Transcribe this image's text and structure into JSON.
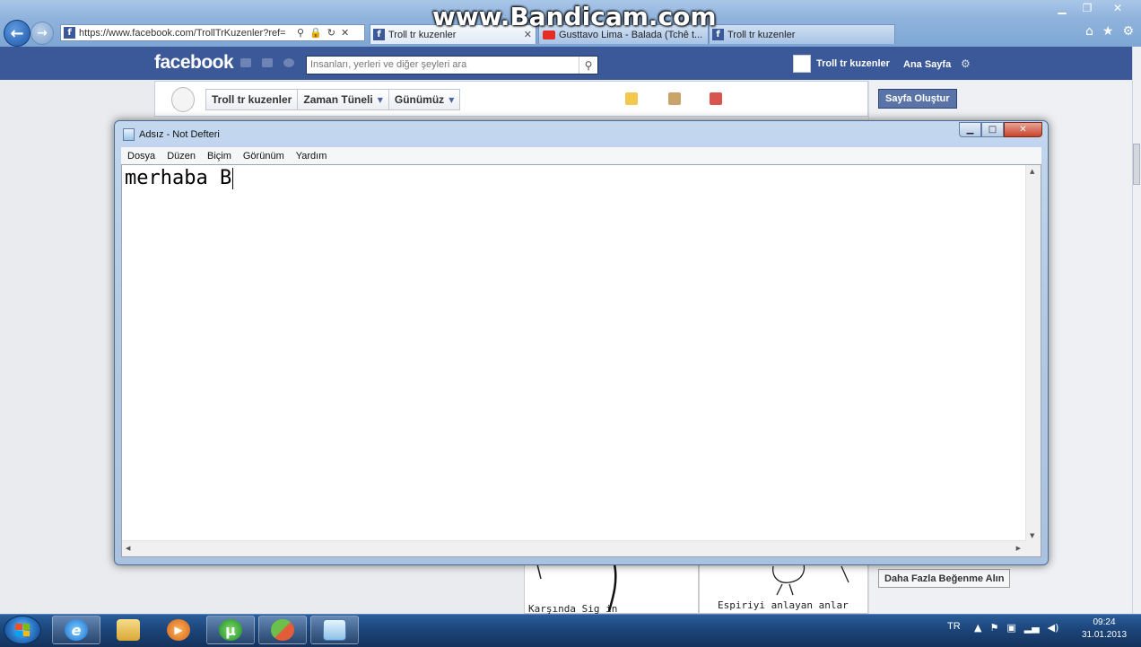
{
  "watermark": "www.Bandicam.com",
  "browser": {
    "address": "https://www.facebook.com/TrollTrKuzenler?ref=",
    "tabs": [
      {
        "label": "Troll tr kuzenler",
        "active": true
      },
      {
        "label": "Gusttavo Lima - Balada (Tchê t...",
        "active": false
      },
      {
        "label": "Troll tr kuzenler",
        "active": false
      }
    ]
  },
  "facebook": {
    "logo": "facebook",
    "search_placeholder": "Insanları, yerleri ve diğer şeyleri ara",
    "user_name": "Troll tr kuzenler",
    "home_link": "Ana Sayfa",
    "brand_color": "#3b5998",
    "timeline_nav": [
      "Troll tr kuzenler",
      "Zaman Tüneli",
      "Günümüz"
    ],
    "create_page_button": "Sayfa Oluştur",
    "more_likes_button": "Daha Fazla Beğenme Alın",
    "post_captions": [
      "Karşında Sig in",
      "Espiriyi anlayan anlar"
    ]
  },
  "notepad": {
    "title": "Adsız - Not Defteri",
    "menu": [
      "Dosya",
      "Düzen",
      "Biçim",
      "Görünüm",
      "Yardım"
    ],
    "content": "merhaba B"
  },
  "taskbar": {
    "language": "TR",
    "time": "09:24",
    "date": "31.01.2013"
  }
}
